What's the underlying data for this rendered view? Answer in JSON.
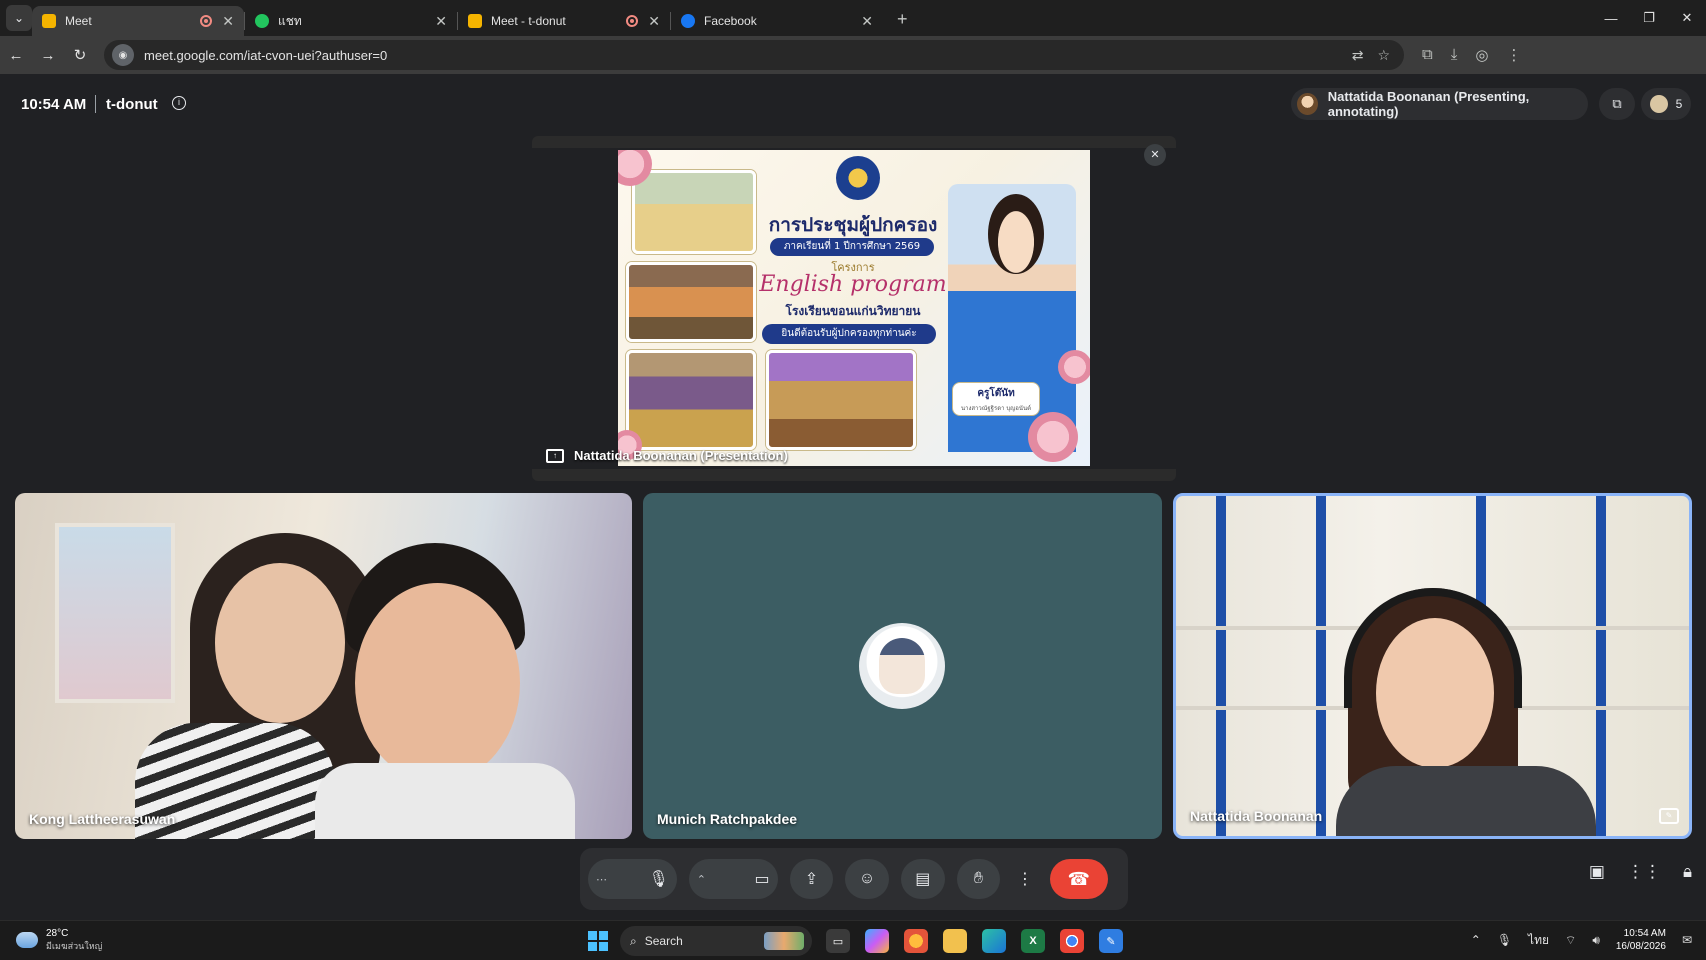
{
  "browser": {
    "tabs": [
      {
        "title": "Meet",
        "favicon_color": "#f5b400",
        "recording": true,
        "active": true
      },
      {
        "title": "แชท",
        "favicon_color": "#22c55e",
        "recording": false,
        "active": false
      },
      {
        "title": "Meet - t-donut",
        "favicon_color": "#f5b400",
        "recording": true,
        "active": false
      },
      {
        "title": "Facebook",
        "favicon_color": "#1877f2",
        "recording": false,
        "active": false
      }
    ],
    "new_tab": "+",
    "url": "meet.google.com/iat-cvon-uei?authuser=0"
  },
  "meet": {
    "time": "10:54 AM",
    "meeting_code": "t-donut",
    "presenter_status": "Nattatida Boonanan (Presenting, annotating)",
    "participant_count": "5",
    "presentation_label": "Nattatida Boonanan (Presentation)",
    "slide": {
      "title": "การประชุมผู้ปกครอง",
      "term": "ภาคเรียนที่ 1 ปีการศึกษา 2569",
      "project": "โครงการ",
      "program": "English program",
      "school": "โรงเรียนขอนแก่นวิทยายน",
      "welcome": "ยินดีต้อนรับผู้ปกครองทุกท่านค่ะ",
      "teacher_title": "ครูโต๊นัท",
      "teacher_sub": "นางสาวณัฐฐิรดา บุญอนันต์"
    },
    "tiles": [
      {
        "name": "Kong Lattheerasuwan"
      },
      {
        "name": "Munich Ratchpakdee"
      },
      {
        "name": "Nattatida Boonanan"
      }
    ],
    "accent": "#8ab4f8",
    "end_call_color": "#ea4335"
  },
  "taskbar": {
    "temperature": "28°C",
    "weather_desc": "มีเมฆส่วนใหญ่",
    "search_placeholder": "Search",
    "language": "ไทย",
    "clock_time": "10:54 AM",
    "clock_date": "16/08/2026"
  }
}
